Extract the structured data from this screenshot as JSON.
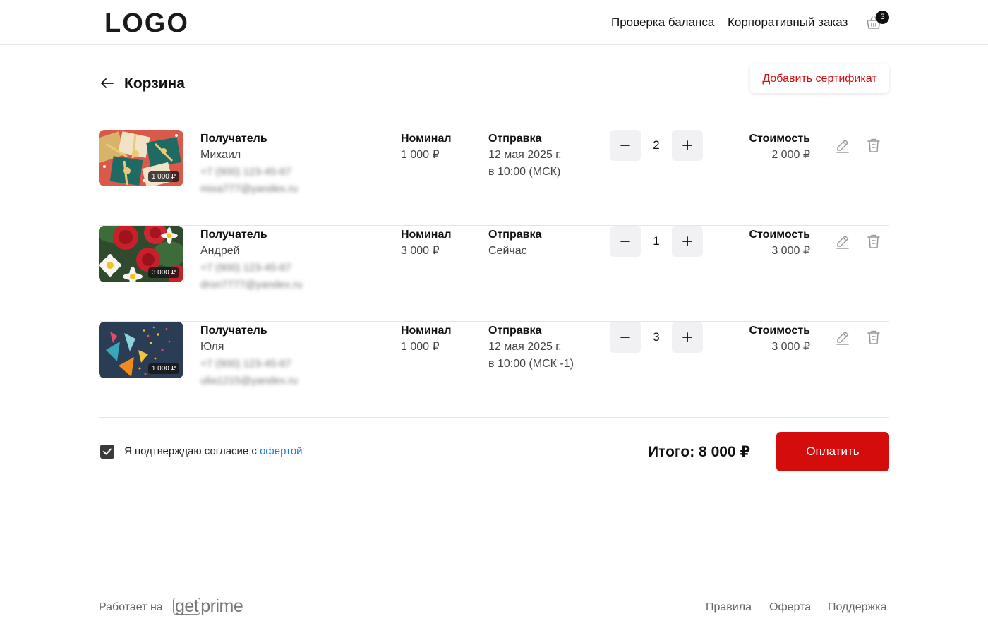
{
  "header": {
    "logo": "LOGO",
    "nav": {
      "balance": "Проверка баланса",
      "corporate": "Корпоративный заказ"
    },
    "cart_count": "3"
  },
  "page": {
    "title": "Корзина",
    "add_certificate": "Добавить сертификат"
  },
  "labels": {
    "recipient": "Получатель",
    "nominal": "Номинал",
    "send": "Отправка",
    "cost": "Стоимость"
  },
  "items": [
    {
      "thumb_price": "1 000 ₽",
      "recipient_name": "Михаил",
      "phone": "+7 (900) 123-45-67",
      "email": "mixa777@yandex.ru",
      "nominal": "1 000 ₽",
      "send_line1": "12 мая 2025 г.",
      "send_line2": "в 10:00 (МСК)",
      "quantity": "2",
      "cost": "2 000 ₽"
    },
    {
      "thumb_price": "3 000 ₽",
      "recipient_name": "Андрей",
      "phone": "+7 (900) 123-45-67",
      "email": "dron7777@yandex.ru",
      "nominal": "3 000 ₽",
      "send_line1": "Сейчас",
      "send_line2": "",
      "quantity": "1",
      "cost": "3 000 ₽"
    },
    {
      "thumb_price": "1 000 ₽",
      "recipient_name": "Юля",
      "phone": "+7 (900) 123-45-67",
      "email": "ulia1215@yandex.ru",
      "nominal": "1 000 ₽",
      "send_line1": "12 мая 2025 г.",
      "send_line2": "в 10:00 (МСК -1)",
      "quantity": "3",
      "cost": "3 000 ₽"
    }
  ],
  "checkout": {
    "agree_text": "Я подтверждаю согласие с ",
    "agree_link": "офертой",
    "agreed": true,
    "total": "Итого: 8 000 ₽",
    "pay": "Оплатить"
  },
  "footer": {
    "powered_by": "Работает на",
    "brand_g": "get",
    "brand_rest": "prime",
    "links": [
      "Правила",
      "Оферта",
      "Поддержка"
    ]
  },
  "colors": {
    "accent": "#d40c0c",
    "link": "#1d7adf"
  }
}
